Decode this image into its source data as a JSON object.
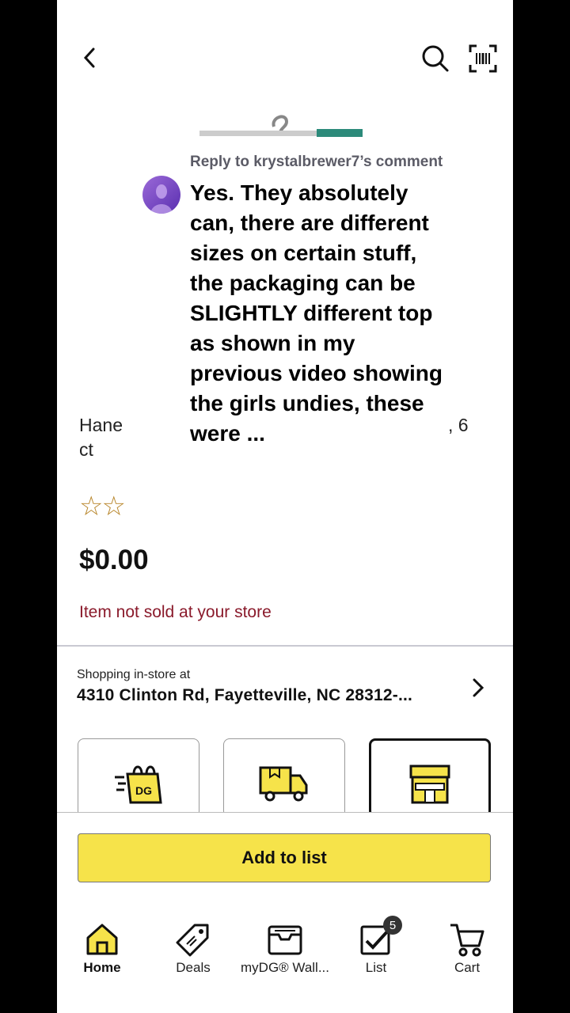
{
  "header": {
    "back_icon": "chevron-left-icon",
    "search_icon": "search-icon",
    "scan_icon": "barcode-scan-icon"
  },
  "product": {
    "name_left_1": "Hane",
    "name_right_1": ", 6",
    "name_left_2": "ct",
    "rating_stars": "☆☆",
    "price": "$0.00",
    "availability": "Item not sold at your store"
  },
  "comment": {
    "reply_to": "Reply to krystalbrewer7’s comment",
    "text": "Yes. They absolutely can, there are different sizes on certain stuff, the packaging can be SLIGHTLY different top as shown in my previous video showing the girls undies, these were ..."
  },
  "store": {
    "label": "Shopping in-store at",
    "address": "4310 Clinton Rd, Fayetteville, NC 28312-..."
  },
  "fulfillment_options": [
    {
      "name": "pickup-bag-icon"
    },
    {
      "name": "delivery-truck-icon"
    },
    {
      "name": "store-icon"
    }
  ],
  "actions": {
    "add_to_list": "Add to list"
  },
  "nav": {
    "home": "Home",
    "deals": "Deals",
    "wallet": "myDG® Wall...",
    "list": "List",
    "list_badge": "5",
    "cart": "Cart"
  },
  "colors": {
    "accent_yellow": "#f6e34a",
    "alert_red": "#8a1a2b"
  }
}
